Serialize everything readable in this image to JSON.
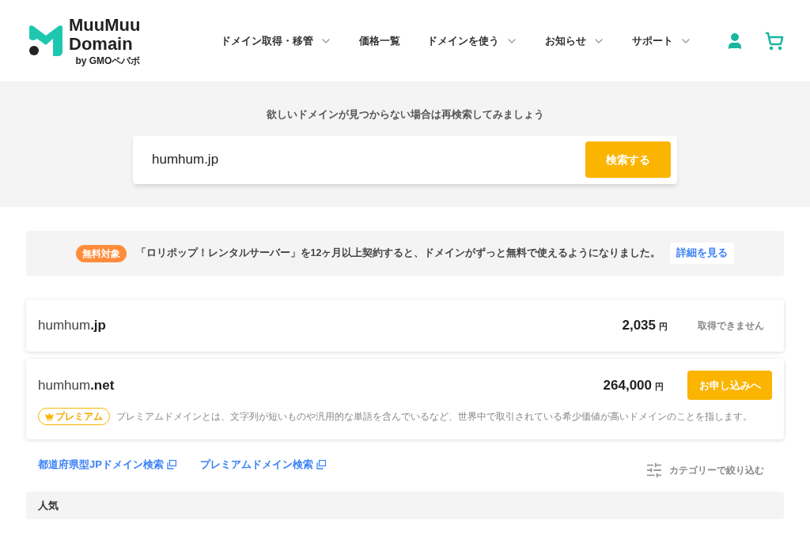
{
  "logo": {
    "line1": "MuuMuu",
    "line2": "Domain",
    "byline": "by GMOペパボ"
  },
  "nav": [
    {
      "label": "ドメイン取得・移管",
      "has_menu": true
    },
    {
      "label": "価格一覧",
      "has_menu": false
    },
    {
      "label": "ドメインを使う",
      "has_menu": true
    },
    {
      "label": "お知らせ",
      "has_menu": true
    },
    {
      "label": "サポート",
      "has_menu": true
    }
  ],
  "search": {
    "prompt": "欲しいドメインが見つからない場合は再検索してみましょう",
    "value": "humhum.jp",
    "button": "検索する"
  },
  "notice": {
    "badge": "無料対象",
    "text": "「ロリポップ！レンタルサーバー」を12ヶ月以上契約すると、ドメインがずっと無料で使えるようになりました。",
    "link": "詳細を見る"
  },
  "results": [
    {
      "name": "humhum",
      "tld": ".jp",
      "price": "2,035",
      "unit": "円",
      "kind": "unavailable",
      "action": "取得できません"
    },
    {
      "name": "humhum",
      "tld": ".net",
      "price": "264,000",
      "unit": "円",
      "kind": "available",
      "action": "お申し込みへ",
      "premium": {
        "badge": "プレミアム",
        "text": "プレミアムドメインとは、文字列が短いものや汎用的な単語を含んでいるなど、世界中で取引されている希少価値が高いドメインのことを指します。"
      }
    }
  ],
  "links": [
    "都道府県型JPドメイン検索",
    "プレミアムドメイン検索"
  ],
  "filter": "カテゴリーで絞り込む",
  "section_title": "人気"
}
